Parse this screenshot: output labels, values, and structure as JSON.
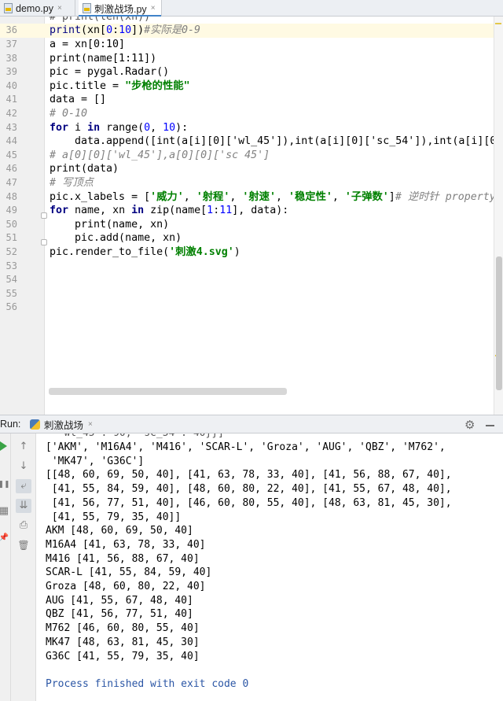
{
  "tabs": [
    {
      "label": "demo.py",
      "close": "×"
    },
    {
      "label": "刺激战场.py",
      "close": "×"
    }
  ],
  "editor": {
    "partial_top": "# print(len(xn))",
    "line_numbers": [
      "36",
      "37",
      "38",
      "39",
      "40",
      "41",
      "42",
      "43",
      "44",
      "45",
      "46",
      "47",
      "48",
      "49",
      "50",
      "51",
      "52",
      "53",
      "54",
      "55",
      "56"
    ],
    "lines": [
      {
        "n": "36",
        "t1": "print",
        "t2": "(xn[",
        "t3": "0",
        "t4": ":",
        "t5": "10",
        "t6": "])",
        "t7": "#实际是0-9"
      },
      {
        "n": "37",
        "text": "a = xn[0:10]"
      },
      {
        "n": "38",
        "text": "print(name[1:11])"
      },
      {
        "n": "39",
        "text": "pic = pygal.Radar()"
      },
      {
        "n": "40",
        "t1": "pic.title = ",
        "t2": "\"步枪的性能\""
      },
      {
        "n": "41",
        "text": "data = []"
      },
      {
        "n": "42",
        "text": "# 0-10"
      },
      {
        "n": "43",
        "k1": "for",
        "t1": " i ",
        "k2": "in",
        "t2": " range(",
        "n1": "0",
        "t3": ", ",
        "n2": "10",
        "t4": "):"
      },
      {
        "n": "44",
        "text": "    data.append([int(a[i][0]['wl_45']),int(a[i][0]['sc_54']),int(a[i][0]["
      },
      {
        "n": "45",
        "text": "# a[0][0]['wl_45'],a[0][0]['sc 45']"
      },
      {
        "n": "46",
        "text": "print(data)"
      },
      {
        "n": "47",
        "text": "# 写顶点"
      },
      {
        "n": "48",
        "t1": "pic.x_labels = [",
        "s1": "'威力'",
        "t2": ", ",
        "s2": "'射程'",
        "t3": ", ",
        "s3": "'射速'",
        "t4": ", ",
        "s4": "'稳定性'",
        "t5": ", ",
        "s5": "'子弹数'",
        "t6": "]",
        "c1": "# 逆时针 property"
      },
      {
        "n": "49",
        "k1": "for",
        "t1": " name, xn ",
        "k2": "in",
        "t2": " zip(name[",
        "n1": "1",
        "t3": ":",
        "n2": "11",
        "t4": "], data):"
      },
      {
        "n": "50",
        "text": "    print(name, xn)"
      },
      {
        "n": "51",
        "text": "    pic.add(name, xn)"
      },
      {
        "n": "52",
        "t1": "pic.render_to_file(",
        "s1": "'刺激4.svg'",
        "t2": ")"
      }
    ]
  },
  "run": {
    "label": "Run:",
    "tab_label": "刺激战场",
    "tab_close": "×",
    "output": [
      "  'wl_45': 90, 'sc_54': 40}}]",
      "['AKM', 'M16A4', 'M416', 'SCAR-L', 'Groza', 'AUG', 'QBZ', 'M762',",
      " 'MK47', 'G36C']",
      "[[48, 60, 69, 50, 40], [41, 63, 78, 33, 40], [41, 56, 88, 67, 40],",
      " [41, 55, 84, 59, 40], [48, 60, 80, 22, 40], [41, 55, 67, 48, 40],",
      " [41, 56, 77, 51, 40], [46, 60, 80, 55, 40], [48, 63, 81, 45, 30],",
      " [41, 55, 79, 35, 40]]",
      "AKM [48, 60, 69, 50, 40]",
      "M16A4 [41, 63, 78, 33, 40]",
      "M416 [41, 56, 88, 67, 40]",
      "SCAR-L [41, 55, 84, 59, 40]",
      "Groza [48, 60, 80, 22, 40]",
      "AUG [41, 55, 67, 48, 40]",
      "QBZ [41, 56, 77, 51, 40]",
      "M762 [46, 60, 80, 55, 40]",
      "MK47 [48, 63, 81, 45, 30]",
      "G36C [41, 55, 79, 35, 40]",
      "",
      "Process finished with exit code 0"
    ]
  },
  "icons": {
    "gear": "⚙",
    "up_arrow": "↑",
    "down_arrow": "↓",
    "wrap": "⤶",
    "scroll_end": "⇊",
    "print": "⎙",
    "trash": "🗑",
    "pause": "❚❚",
    "layout": "▦",
    "pin": "📌"
  },
  "colors": {
    "keyword": "#000080",
    "string": "#008000",
    "comment": "#808080",
    "number": "#0000ff",
    "current_line": "#fffae3",
    "accent_tab": "#4083c9",
    "run_green": "#3aa346",
    "output_final": "#2b56a5"
  }
}
